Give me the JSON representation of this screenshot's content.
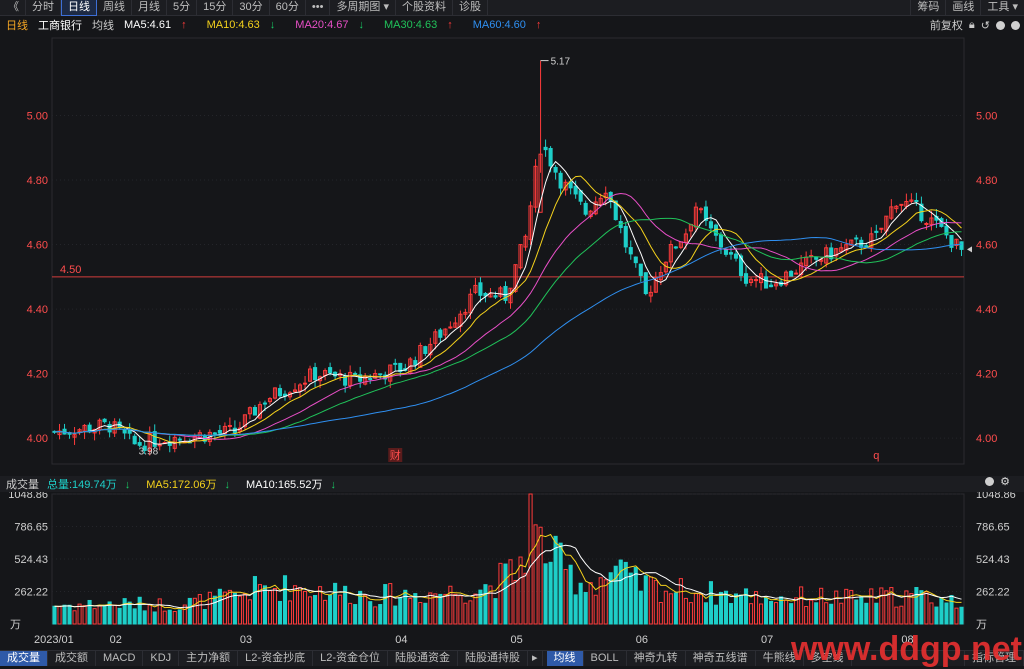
{
  "toolbar": {
    "back": "《",
    "tabs": [
      "分时",
      "日线",
      "周线",
      "月线",
      "5分",
      "15分",
      "30分",
      "60分"
    ],
    "active_tab": 1,
    "more": "•••",
    "multi_period": "多周期图",
    "stock_info": "个股资料",
    "diagnose": "诊股",
    "right": [
      "筹码",
      "画线",
      "工具"
    ]
  },
  "info": {
    "period": "日线",
    "name": "工商银行",
    "ma_label": "均线",
    "ma5": "MA5:4.61",
    "ma10": "MA10:4.63",
    "ma20": "MA20:4.67",
    "ma30": "MA30:4.63",
    "ma60": "MA60:4.60",
    "fuquan": "前复权"
  },
  "colors": {
    "up": "#ff3b3b",
    "down": "#1ecfc9",
    "ma5": "#ffffff",
    "ma10": "#f5d21c",
    "ma20": "#e84fc7",
    "ma30": "#20c25a",
    "ma60": "#2f8ff0",
    "hline": "#d23c3c",
    "axis": "#ff4d4d"
  },
  "volume_info": {
    "label": "成交量",
    "total": "总量:149.74万",
    "ma5": "MA5:172.06万",
    "ma10": "MA10:165.52万"
  },
  "bottom_tabs_left": [
    "成交量",
    "成交额",
    "MACD",
    "KDJ",
    "主力净额",
    "L2-资金抄底",
    "L2-资金仓位",
    "陆股通资金",
    "陆股通持股"
  ],
  "bottom_tabs_right": [
    "均线",
    "BOLL",
    "神奇九转",
    "神奇五线谱",
    "牛熊线",
    "多空线",
    "指标管理"
  ],
  "chart_data": {
    "type": "candlestick",
    "y_ticks": [
      "5.00",
      "4.80",
      "4.60",
      "4.40",
      "4.20",
      "4.00"
    ],
    "y_tick_values": [
      5.0,
      4.8,
      4.6,
      4.4,
      4.2,
      4.0
    ],
    "y_range": [
      3.92,
      5.24
    ],
    "horizontal_line": {
      "value": 4.5,
      "label": "4.50"
    },
    "annotations": {
      "high": "5.17",
      "low": "3.98"
    },
    "event_markers": [
      {
        "label": "财",
        "index": 68
      },
      {
        "label": "q",
        "index": 164
      }
    ],
    "x_ticks": [
      {
        "label": "2023/01",
        "index": 0
      },
      {
        "label": "02",
        "index": 11
      },
      {
        "label": "03",
        "index": 37
      },
      {
        "label": "04",
        "index": 68
      },
      {
        "label": "05",
        "index": 91
      },
      {
        "label": "06",
        "index": 116
      },
      {
        "label": "07",
        "index": 141
      },
      {
        "label": "08",
        "index": 169
      }
    ],
    "vol_ticks": [
      "1048.86",
      "786.65",
      "524.43",
      "262.22"
    ],
    "vol_tick_values": [
      1048.86,
      786.65,
      524.43,
      262.22
    ],
    "vol_unit": "万",
    "keypoints": [
      [
        0,
        4.02
      ],
      [
        11,
        4.04
      ],
      [
        16,
        3.98
      ],
      [
        22,
        4.0
      ],
      [
        36,
        4.02
      ],
      [
        42,
        4.12
      ],
      [
        52,
        4.2
      ],
      [
        60,
        4.18
      ],
      [
        70,
        4.22
      ],
      [
        78,
        4.34
      ],
      [
        84,
        4.45
      ],
      [
        90,
        4.44
      ],
      [
        94,
        4.62
      ],
      [
        97,
        4.92
      ],
      [
        101,
        4.8
      ],
      [
        106,
        4.7
      ],
      [
        110,
        4.78
      ],
      [
        114,
        4.6
      ],
      [
        118,
        4.44
      ],
      [
        122,
        4.56
      ],
      [
        126,
        4.64
      ],
      [
        128,
        4.72
      ],
      [
        130,
        4.66
      ],
      [
        134,
        4.58
      ],
      [
        138,
        4.5
      ],
      [
        143,
        4.48
      ],
      [
        150,
        4.54
      ],
      [
        156,
        4.58
      ],
      [
        164,
        4.62
      ],
      [
        168,
        4.74
      ],
      [
        172,
        4.71
      ],
      [
        176,
        4.66
      ],
      [
        181,
        4.58
      ]
    ],
    "vol_keypoints": [
      [
        0,
        150
      ],
      [
        12,
        160
      ],
      [
        24,
        155
      ],
      [
        36,
        220
      ],
      [
        40,
        280
      ],
      [
        48,
        300
      ],
      [
        56,
        260
      ],
      [
        64,
        230
      ],
      [
        72,
        240
      ],
      [
        80,
        260
      ],
      [
        86,
        300
      ],
      [
        92,
        420
      ],
      [
        95,
        700
      ],
      [
        98,
        620
      ],
      [
        102,
        420
      ],
      [
        106,
        320
      ],
      [
        112,
        420
      ],
      [
        116,
        330
      ],
      [
        122,
        280
      ],
      [
        128,
        260
      ],
      [
        136,
        230
      ],
      [
        144,
        210
      ],
      [
        152,
        220
      ],
      [
        160,
        200
      ],
      [
        166,
        220
      ],
      [
        172,
        230
      ],
      [
        181,
        170
      ]
    ],
    "ma_lengths": [
      5,
      10,
      20,
      30,
      60
    ]
  }
}
